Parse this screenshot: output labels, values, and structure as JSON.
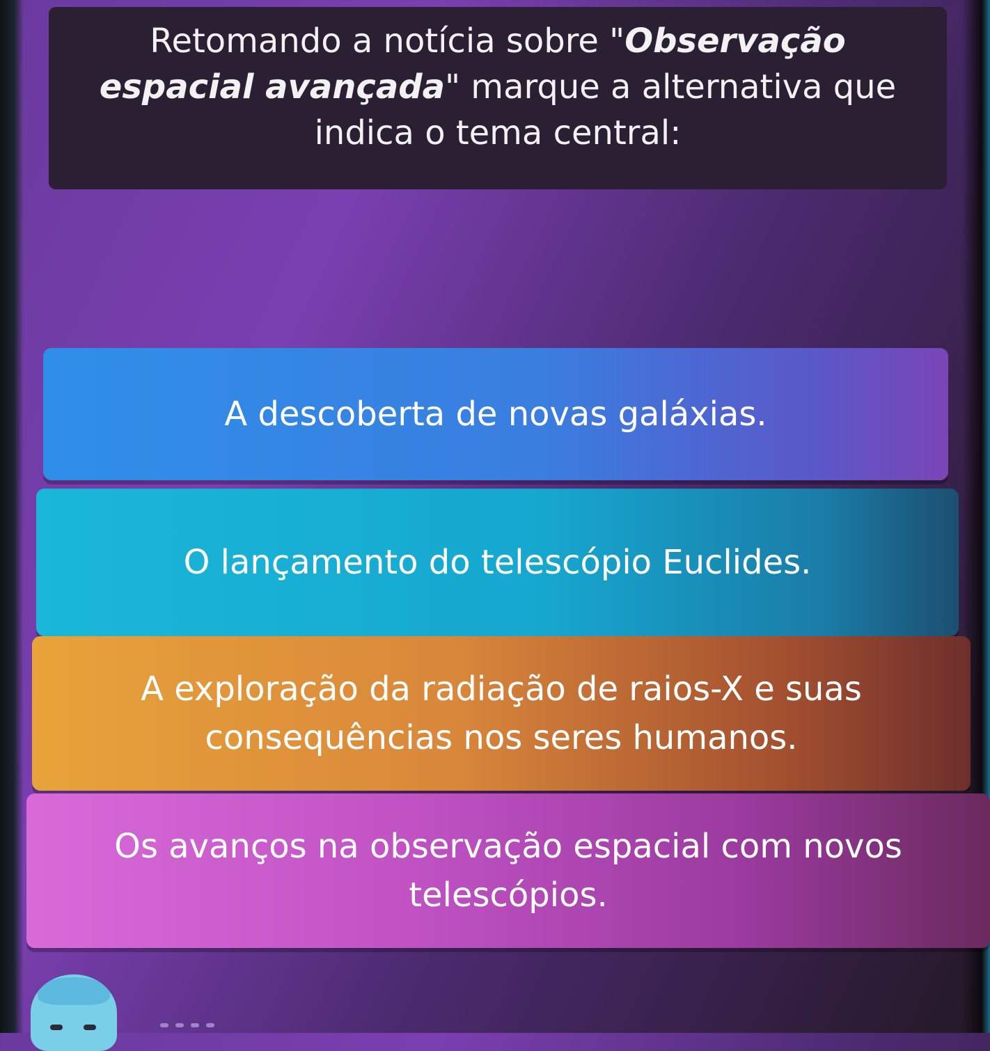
{
  "question": {
    "part1": "Retomando a notícia sobre \"",
    "title": "Observação espacial avançada",
    "part2": "\" marque a alternativa que indica o tema central:"
  },
  "options": [
    {
      "label": "A descoberta de novas galáxias.",
      "color": "#2f8fe8"
    },
    {
      "label": "O lançamento do telescópio Euclides.",
      "color": "#1ab7d8"
    },
    {
      "label": "A exploração da radiação de raios-X e suas consequências nos seres humanos.",
      "color": "#e8a33a"
    },
    {
      "label": "Os avanços na observação espacial com novos telescópios.",
      "color": "#d96ad8"
    }
  ],
  "colors": {
    "background": "#6a3a9e",
    "question_card": "#2b1f33"
  },
  "icons": {
    "avatar": "player-avatar-icon"
  }
}
